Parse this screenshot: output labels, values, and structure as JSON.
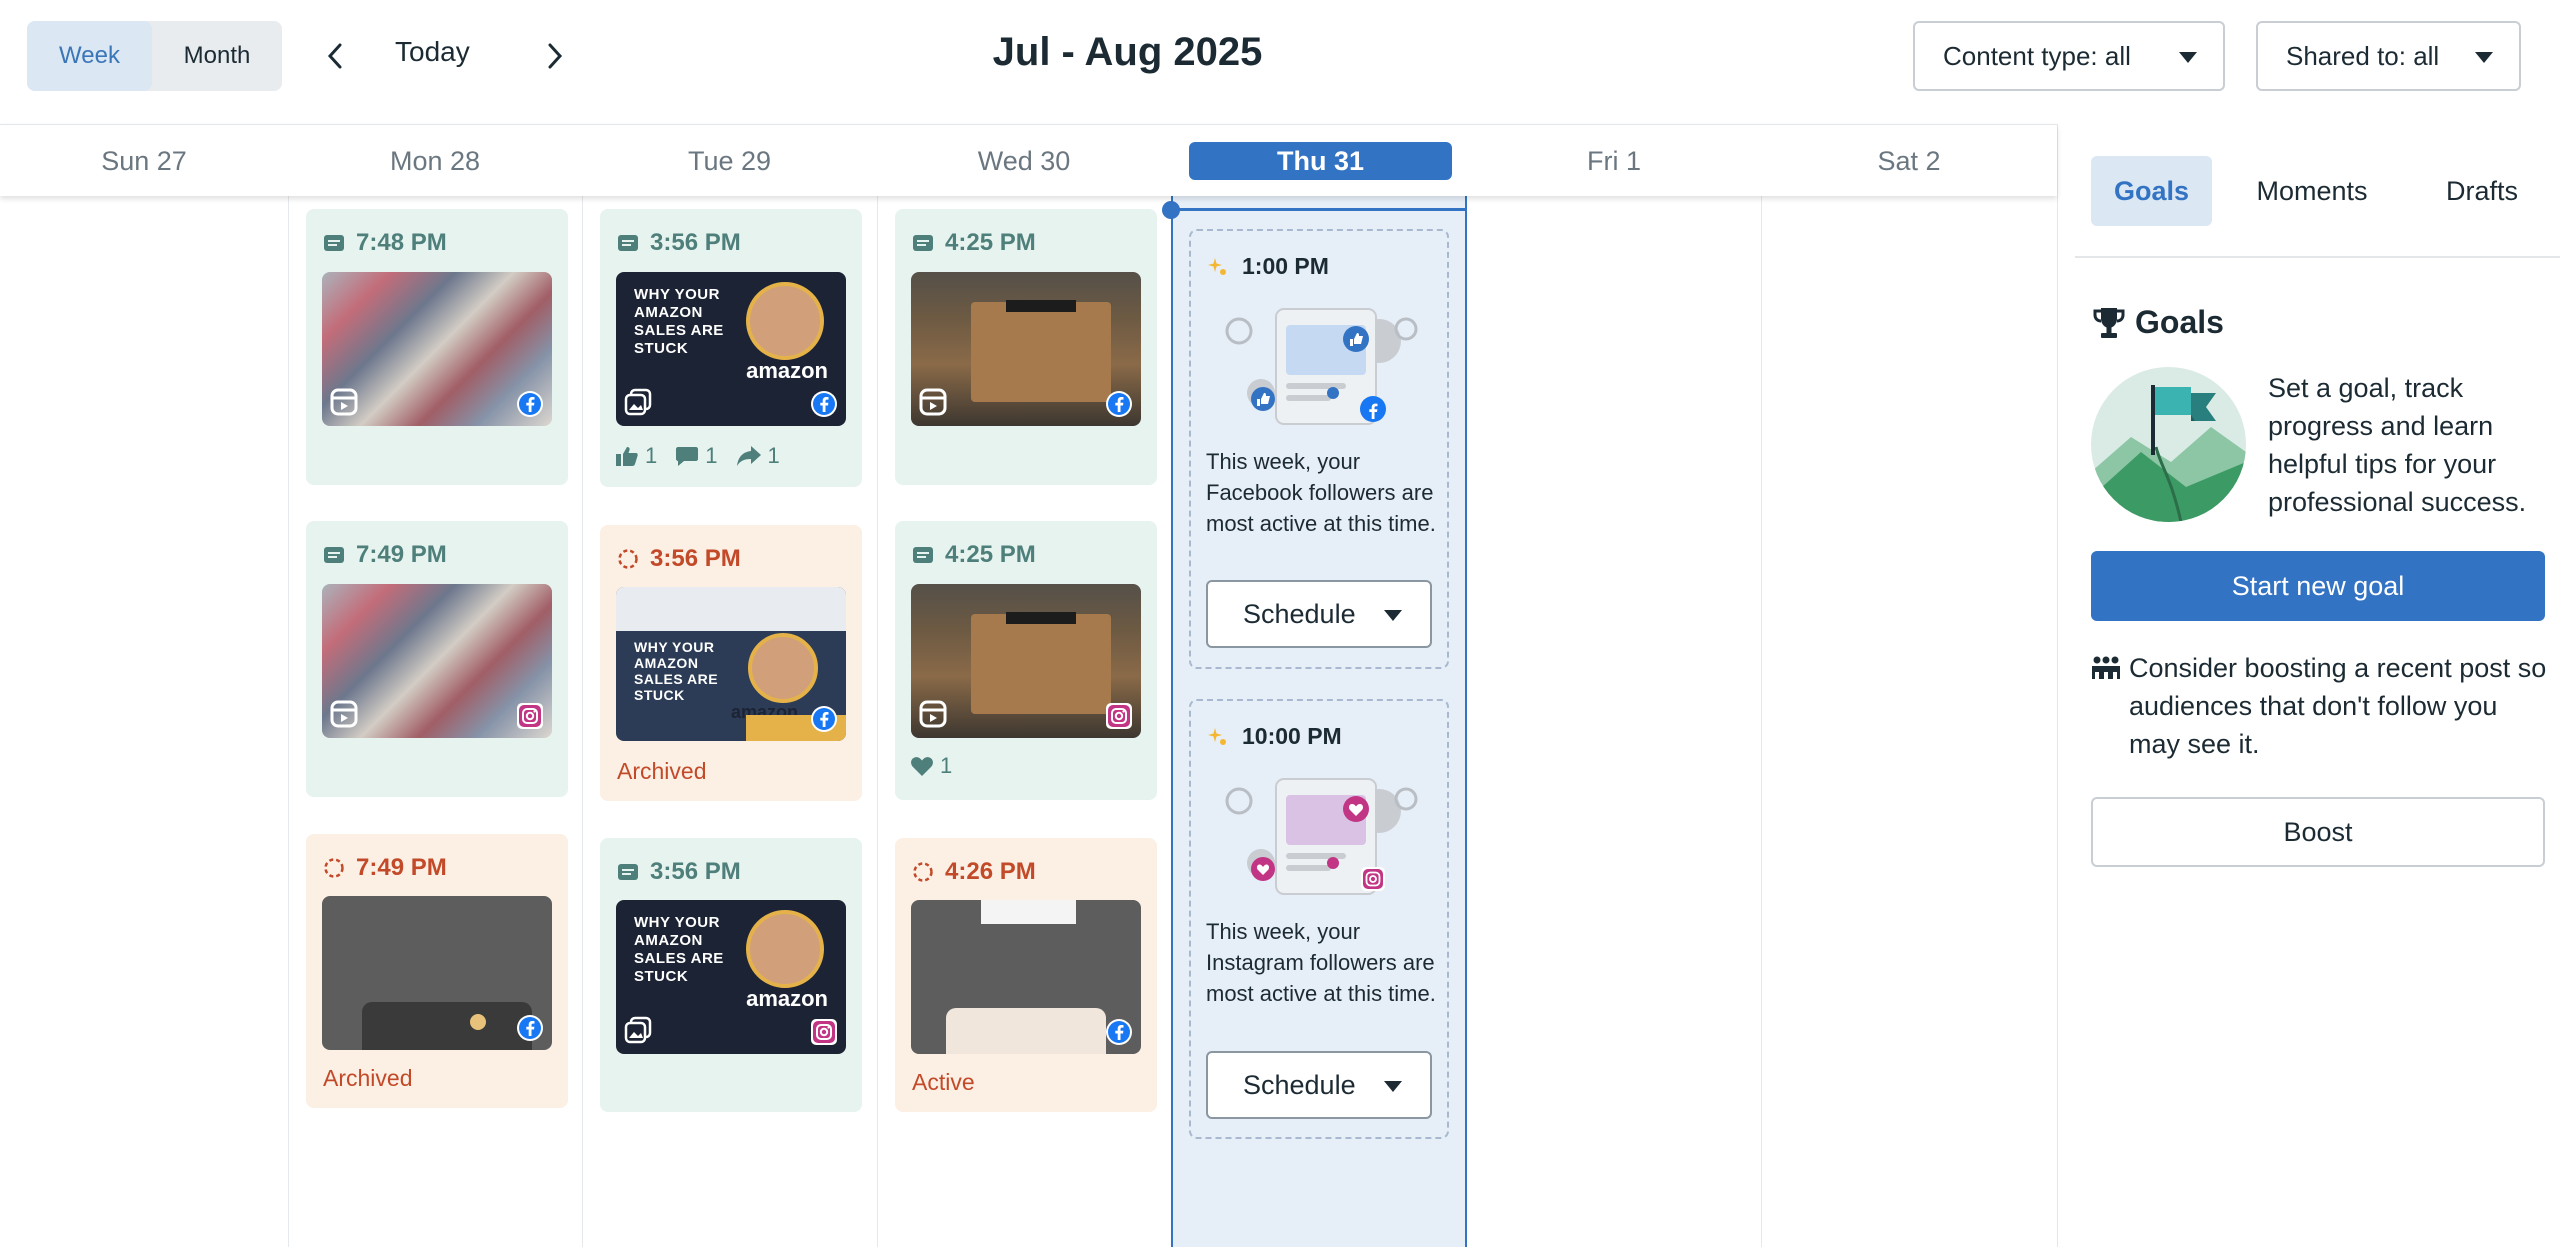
{
  "header": {
    "view_week": "Week",
    "view_month": "Month",
    "today_label": "Today",
    "title": "Jul - Aug 2025",
    "content_type": "Content type: all",
    "shared_to": "Shared to: all"
  },
  "days": [
    "Sun 27",
    "Mon 28",
    "Tue 29",
    "Wed 30",
    "Thu 31",
    "Fri 1",
    "Sat 2"
  ],
  "posts": {
    "mon": [
      {
        "time": "7:48 PM"
      },
      {
        "time": "7:49 PM"
      },
      {
        "time": "7:49 PM",
        "status": "Archived"
      }
    ],
    "tue": [
      {
        "time": "3:56 PM",
        "thumb_lines": [
          "WHY YOUR",
          "AMAZON",
          "SALES ARE",
          "STUCK"
        ],
        "thumb_logo": "amazon",
        "likes": "1",
        "comments": "1",
        "shares": "1"
      },
      {
        "time": "3:56 PM",
        "status": "Archived",
        "thumb_lines": [
          "WHY YOUR",
          "AMAZON",
          "SALES ARE",
          "STUCK"
        ],
        "thumb_logo": "amazon"
      },
      {
        "time": "3:56 PM",
        "thumb_lines": [
          "WHY YOUR",
          "AMAZON",
          "SALES ARE",
          "STUCK"
        ],
        "thumb_logo": "amazon"
      }
    ],
    "wed": [
      {
        "time": "4:25 PM"
      },
      {
        "time": "4:25 PM",
        "hearts": "1"
      },
      {
        "time": "4:26 PM",
        "status": "Active"
      }
    ]
  },
  "recommendations": [
    {
      "time": "1:00 PM",
      "text": "This week, your Facebook followers are most active at this time.",
      "button": "Schedule"
    },
    {
      "time": "10:00 PM",
      "text": "This week, your Instagram followers are most active at this time.",
      "button": "Schedule"
    }
  ],
  "panel": {
    "tabs": [
      "Goals",
      "Moments",
      "Drafts"
    ],
    "goals_heading": "Goals",
    "goals_text": "Set a goal, track progress and learn helpful tips for your professional success.",
    "start_goal": "Start new goal",
    "boost_text": "Consider boosting a recent post so audiences that don't follow you may see it.",
    "boost": "Boost"
  },
  "colors": {
    "accent": "#3373c4",
    "published_bg": "#e6f3ef",
    "draft_bg": "#fcefe4",
    "facebook": "#1877f2",
    "instagram": "#c13584"
  }
}
